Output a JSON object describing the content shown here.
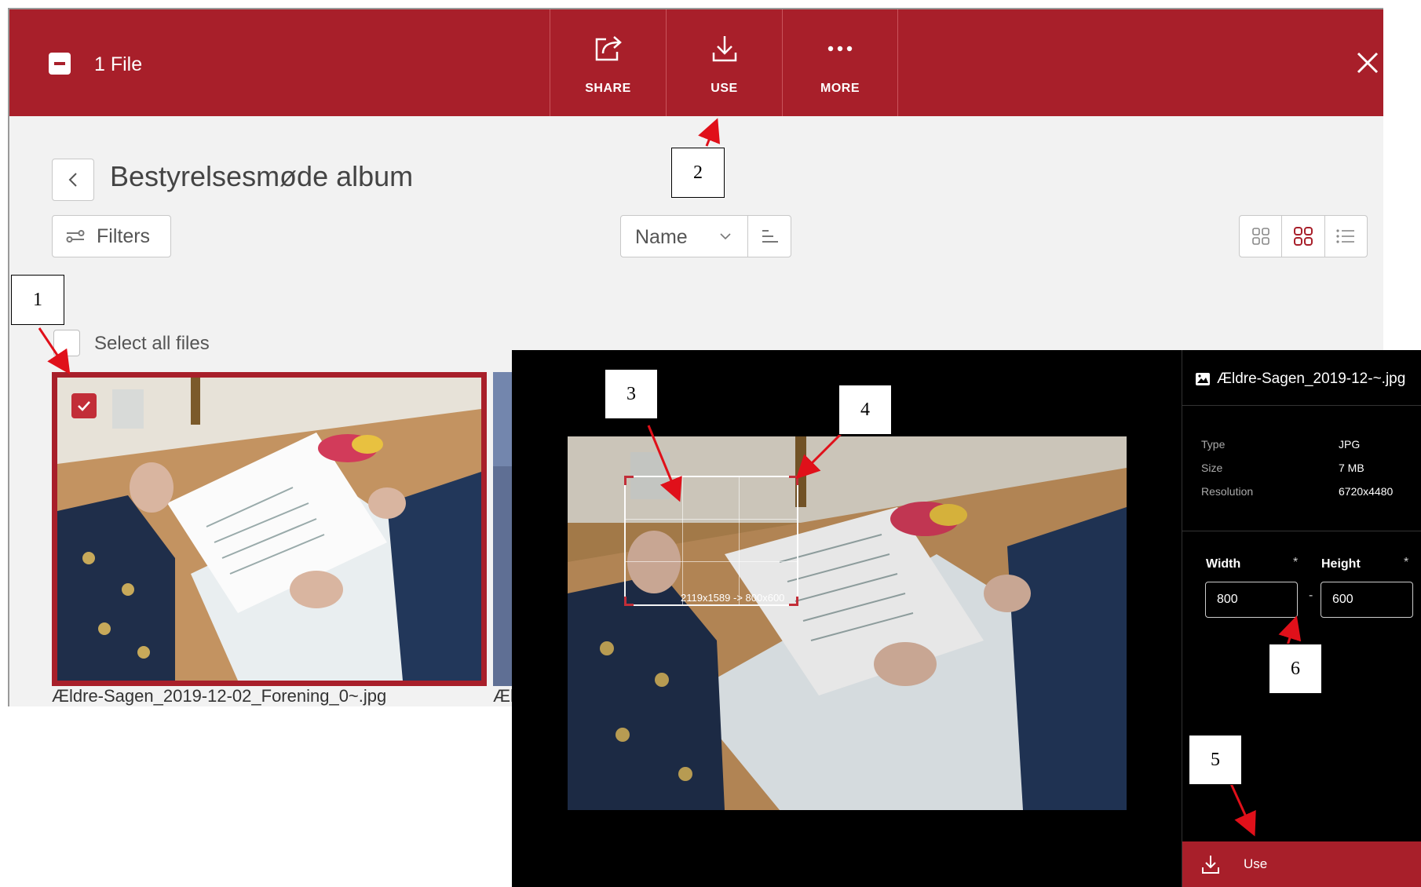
{
  "toolbar": {
    "file_count": "1 File",
    "actions": [
      {
        "label": "SHARE",
        "icon": "share-icon"
      },
      {
        "label": "USE",
        "icon": "download-icon"
      },
      {
        "label": "MORE",
        "icon": "more-icon"
      }
    ],
    "close_icon": "close-icon",
    "color": "#a81f2a"
  },
  "album": {
    "title": "Bestyrelsesmøde album",
    "filters_label": "Filters",
    "sort_value": "Name",
    "select_all_label": "Select all files"
  },
  "files": [
    {
      "name": "Ældre-Sagen_2019-12-02_Forening_0~.jpg",
      "selected": true
    },
    {
      "name": "Æl",
      "selected": false
    }
  ],
  "dialog": {
    "filename": "Ældre-Sagen_2019-12-~.jpg",
    "metadata": [
      {
        "key": "Type",
        "value": "JPG"
      },
      {
        "key": "Size",
        "value": "7 MB"
      },
      {
        "key": "Resolution",
        "value": "6720x4480"
      }
    ],
    "width_label": "Width",
    "height_label": "Height",
    "required_mark": "*",
    "width_value": "800",
    "height_value": "600",
    "separator": "-",
    "crop_info": "2119x1589 -> 800x600",
    "use_button_label": "Use"
  },
  "annotations": [
    "1",
    "2",
    "3",
    "4",
    "5",
    "6"
  ],
  "colors": {
    "accent": "#a81f2a",
    "arrow": "#e0101a",
    "background": "#f2f2f2",
    "dialog": "#000000"
  }
}
